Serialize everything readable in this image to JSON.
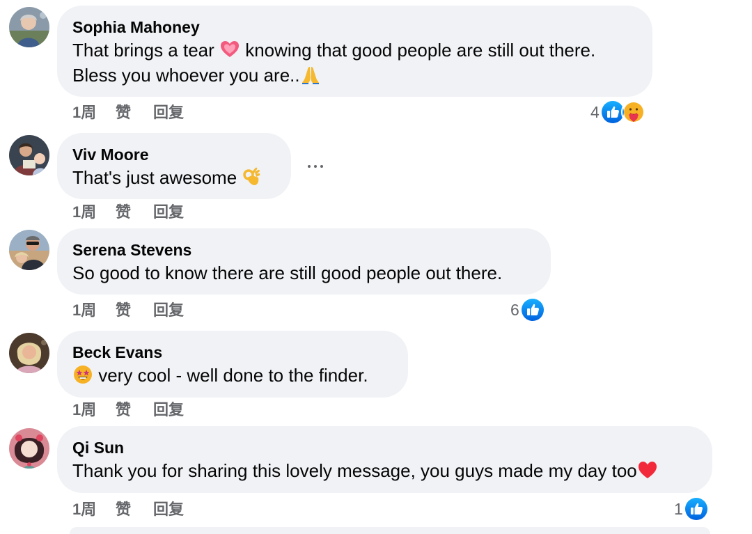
{
  "comments": [
    {
      "author": "Sophia Mahoney",
      "line1_a": "That brings a tear ",
      "line1_emoji": "heart-pulse-emoji",
      "line1_b": " knowing that good people are still out there.",
      "line2_a": "Bless you whoever you are..",
      "line2_emoji": "folded-hands-emoji",
      "time": "1周",
      "like": "赞",
      "reply": "回复",
      "reaction_count": "4",
      "reactions": [
        "like-reaction-icon",
        "care-reaction-icon"
      ]
    },
    {
      "author": "Viv Moore",
      "line1_a": "That's just awesome ",
      "line1_emoji": "ok-hand-emoji",
      "time": "1周",
      "like": "赞",
      "reply": "回复"
    },
    {
      "author": "Serena Stevens",
      "line1_a": "So good to know there are still good people out there.",
      "time": "1周",
      "like": "赞",
      "reply": "回复",
      "reaction_count": "6",
      "reactions": [
        "like-reaction-icon"
      ]
    },
    {
      "author": "Beck Evans",
      "line1_emoji": "star-struck-emoji",
      "line1_b": " very cool - well done to the finder.",
      "time": "1周",
      "like": "赞",
      "reply": "回复"
    },
    {
      "author": "Qi Sun",
      "line1_a": "Thank you for sharing this lovely message, you guys made my day too",
      "line1_emoji": "red-heart-emoji",
      "time": "1周",
      "like": "赞",
      "reply": "回复",
      "reaction_count": "1",
      "reactions": [
        "like-reaction-icon"
      ]
    }
  ],
  "colors": {
    "bubble": "#f0f2f5",
    "meta_text": "#65676b",
    "like_blue": "#1877f2",
    "text": "#050505"
  }
}
